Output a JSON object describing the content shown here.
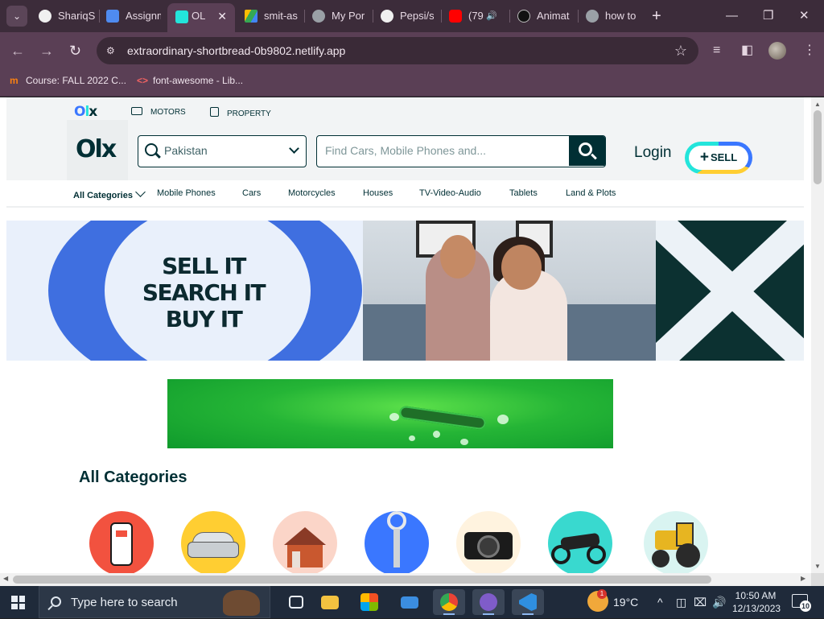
{
  "browser": {
    "tabs": [
      {
        "title": "ShariqS",
        "favicon": "github-icon",
        "color": "#f0f0f0"
      },
      {
        "title": "Assignm",
        "favicon": "classroom-icon",
        "color": "#4f8bf0"
      },
      {
        "title": "OL",
        "favicon": "olx-icon",
        "color": "#23e5db",
        "active": true
      },
      {
        "title": "smit-as",
        "favicon": "drive-icon",
        "color": "#34a853"
      },
      {
        "title": "My Por",
        "favicon": "globe-icon",
        "color": "#9aa0a6"
      },
      {
        "title": "Pepsi/s",
        "favicon": "github-icon",
        "color": "#f0f0f0"
      },
      {
        "title": "(79",
        "favicon": "youtube-icon",
        "color": "#ff0000",
        "audio": true
      },
      {
        "title": "Animat",
        "favicon": "amazon-icon",
        "color": "#111111"
      },
      {
        "title": "how to",
        "favicon": "globe-icon",
        "color": "#9aa0a6"
      }
    ],
    "close_glyph": "✕",
    "new_tab_glyph": "+",
    "audio_glyph": "🔊",
    "window": {
      "minimize": "—",
      "maximize": "❐",
      "close": "✕"
    },
    "nav": {
      "back": "←",
      "forward": "→",
      "reload": "↻"
    },
    "url": "extraordinary-shortbread-0b9802.netlify.app",
    "tune_glyph": "⚙",
    "star_glyph": "☆",
    "toolbar_icons": {
      "media": "≡",
      "sidepanel": "◧",
      "menu": "⋮"
    },
    "bookmarks": [
      {
        "label": "Course: FALL 2022 C...",
        "icon": "moodle-icon",
        "glyph": "m",
        "color": "#f98012"
      },
      {
        "label": "font-awesome - Lib...",
        "icon": "code-icon",
        "glyph": "<>",
        "color": "#f06262"
      }
    ]
  },
  "olx": {
    "top_links": [
      {
        "label": "MOTORS",
        "icon": "car-icon"
      },
      {
        "label": "PROPERTY",
        "icon": "building-icon"
      }
    ],
    "logo": {
      "o": "O",
      "l": "l",
      "x": "x"
    },
    "location": {
      "value": "Pakistan"
    },
    "search": {
      "placeholder": "Find Cars, Mobile Phones and..."
    },
    "login_label": "Login",
    "sell_label": "SELL",
    "sell_plus": "+",
    "categories": [
      "All Categories",
      "Mobile Phones",
      "Cars",
      "Motorcycles",
      "Houses",
      "TV-Video-Audio",
      "Tablets",
      "Land & Plots"
    ],
    "banner": {
      "lines": [
        "SELL IT",
        "SEARCH IT",
        "BUY IT"
      ]
    },
    "all_categories_title": "All Categories",
    "category_icons": [
      {
        "name": "mobiles",
        "bg": "#f2523f"
      },
      {
        "name": "vehicles",
        "bg": "#ffce32"
      },
      {
        "name": "property-for-sale",
        "bg": "#fbd5c8"
      },
      {
        "name": "property-for-rent",
        "bg": "#3a77ff"
      },
      {
        "name": "electronics",
        "bg": "#fff3df"
      },
      {
        "name": "bikes",
        "bg": "#39d9cf"
      },
      {
        "name": "business-industrial",
        "bg": "#d9f4f1"
      }
    ]
  },
  "taskbar": {
    "search_placeholder": "Type here to search",
    "apps": [
      {
        "name": "task-view",
        "color": "#e9eef5"
      },
      {
        "name": "file-explorer",
        "color": "#f3c240"
      },
      {
        "name": "microsoft-store",
        "color": "#3b8de0"
      },
      {
        "name": "mail",
        "color": "#3b8de0"
      },
      {
        "name": "chrome",
        "color": "#34a853",
        "running": true
      },
      {
        "name": "github-desktop",
        "color": "#7f5cc9",
        "running": true
      },
      {
        "name": "vscode",
        "color": "#2f8fe0",
        "running": true
      }
    ],
    "weather_badge": "1",
    "temperature": "19°C",
    "tray": {
      "chevron": "^",
      "meet": "◫",
      "network": "⌧",
      "volume": "🔊"
    },
    "time": "10:50 AM",
    "date": "12/13/2023",
    "notifications": "10"
  }
}
